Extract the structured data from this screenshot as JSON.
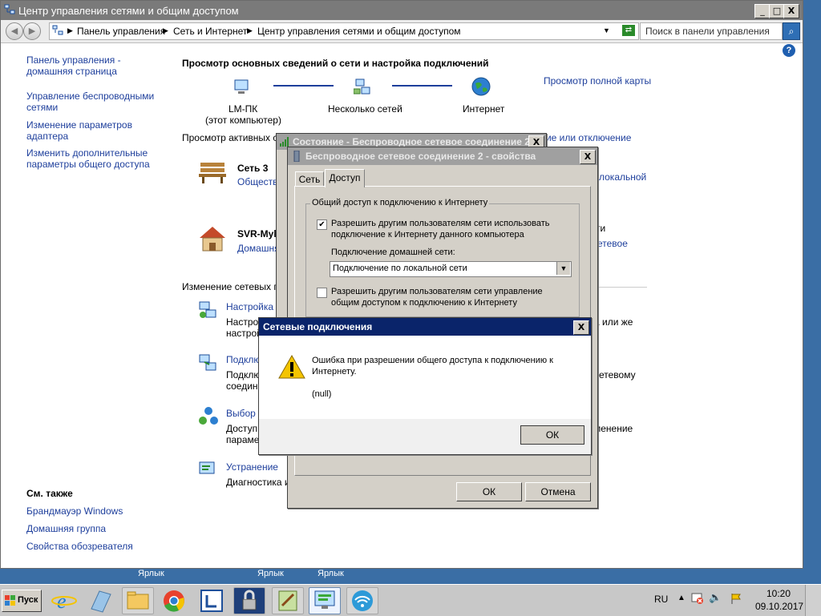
{
  "window": {
    "title": "Центр управления сетями и общим доступом",
    "btn_min": "_",
    "btn_max": "□",
    "btn_close": "X"
  },
  "address": {
    "breadcrumb": [
      "Панель управления",
      "Сеть и Интернет",
      "Центр управления сетями и общим доступом"
    ],
    "search_placeholder": "Поиск в панели управления"
  },
  "sidebar": {
    "items": [
      "Панель управления - домашняя страница",
      "Управление беспроводными сетями",
      "Изменение параметров адаптера",
      "Изменить дополнительные параметры общего доступа"
    ],
    "see_also_title": "См. также",
    "see_also": [
      "Брандмауэр Windows",
      "Домашняя группа",
      "Свойства обозревателя"
    ]
  },
  "main": {
    "heading": "Просмотр основных сведений о сети и настройка подключений",
    "map_link": "Просмотр полной карты",
    "nodes": {
      "computer": "LM-ПК",
      "computer_sub": "(этот компьютер)",
      "networks": "Несколько сетей",
      "internet": "Интернет"
    },
    "active_label": "Просмотр активных с",
    "connect_link": "рчение или отключение",
    "net1_name": "Сеть  3",
    "net1_type": "Обществ",
    "net1_right": "локальной",
    "net2_name": "SVR-Myl",
    "net2_type": "Домашня",
    "net2_right1": "ти",
    "net2_right2": "сетевое",
    "change_label": "Изменение сетевых па",
    "tasks": [
      {
        "title": "Настройка н",
        "desc1": "Настрой",
        "desc2": "настрой",
        "right": "а или же"
      },
      {
        "title": "Подклю",
        "desc1": "Подклю",
        "desc2": "соедине",
        "right": "сетевому"
      },
      {
        "title": "Выбор д",
        "desc1": "Доступ",
        "desc2": "парамет",
        "right": "менение"
      },
      {
        "title": "Устранение",
        "desc1": "Диагностика и",
        "desc2": "",
        "right": ""
      }
    ]
  },
  "status_dialog": {
    "title": "Состояние - Беспроводное сетевое соединение 2",
    "close": "X"
  },
  "props_dialog": {
    "title": "Беспроводное сетевое соединение 2 - свойства",
    "close": "X",
    "tabs": [
      "Сеть",
      "Доступ"
    ],
    "group_title": "Общий доступ к подключению к Интернету",
    "check1_line1": "Разрешить другим пользователям сети использовать",
    "check1_line2": "подключение к Интернету данного компьютера",
    "check1_state": "✔",
    "home_net_label": "Подключение домашней сети:",
    "home_net_value": "Подключение по локальной сети",
    "check2_line1": "Разрешить другим пользователям сети управление",
    "check2_line2": "общим доступом к подключению к Интернету",
    "ok": "ОК",
    "cancel": "Отмена"
  },
  "error_dialog": {
    "title": "Сетевые подключения",
    "close": "X",
    "message_line1": "Ошибка при разрешении общего доступа к подключению к",
    "message_line2": "Интернету.",
    "detail": "(null)",
    "ok": "ОК"
  },
  "desktop": {
    "labels": [
      "Ярлык",
      "Ярлык",
      "Ярлык"
    ]
  },
  "taskbar": {
    "start": "Пуск",
    "lang": "RU",
    "time": "10:20",
    "date": "09.10.2017",
    "icons": [
      "ie-icon",
      "notepad-icon",
      "explorer-icon",
      "chrome-icon",
      "app-icon",
      "lock-icon",
      "edit-icon",
      "network-center-icon",
      "wifi-icon"
    ]
  }
}
